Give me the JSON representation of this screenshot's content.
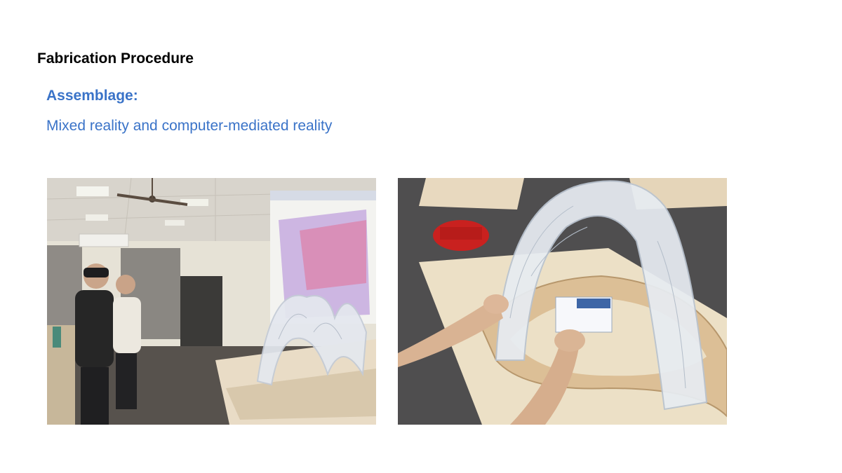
{
  "slide": {
    "title": "Fabrication Procedure",
    "subhead": "Assemblage:",
    "subtext": "Mixed reality and computer-mediated reality"
  },
  "photos": [
    {
      "name": "classroom-mixed-reality-photo"
    },
    {
      "name": "hands-holding-arch-photo"
    }
  ],
  "colors": {
    "title": "#000000",
    "accent": "#3a73c8"
  }
}
